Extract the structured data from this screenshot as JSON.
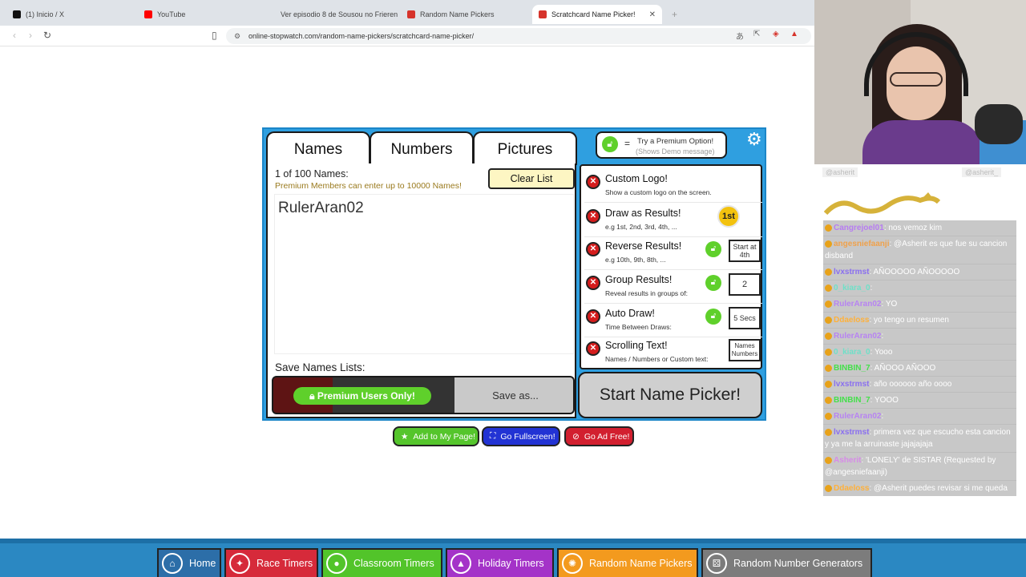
{
  "browser": {
    "tabs": [
      {
        "label": "(1) Inicio / X",
        "icon": "x-logo-icon",
        "color": "#111111"
      },
      {
        "label": "YouTube",
        "icon": "youtube-icon",
        "color": "#ff0000"
      },
      {
        "label": "Ver episodio 8 de Sousou no Frieren",
        "icon": "crunchy-icon",
        "color": "#f47521"
      },
      {
        "label": "Random Name Pickers",
        "icon": "stopwatch-icon",
        "color": "#d6332b"
      },
      {
        "label": "Scratchcard Name Picker!",
        "icon": "stopwatch-icon",
        "color": "#d6332b"
      }
    ],
    "close_glyph": "✕",
    "new_tab_glyph": "+",
    "url": "online-stopwatch.com/random-name-pickers/scratchcard-name-picker/"
  },
  "app": {
    "tabs": [
      "Names",
      "Numbers",
      "Pictures"
    ],
    "count_text": "1 of 100 Names:",
    "premium_note": "Premium Members can enter  up to 10000 Names!",
    "clear_label": "Clear List",
    "names_value": "RulerAran02",
    "save_label": "Save Names Lists:",
    "premium_only_label": "Premium Users Only!",
    "save_as_label": "Save as...",
    "premium_option_eq": "=",
    "premium_option_title": "Try a Premium Option!",
    "premium_option_sub": "(Shows Demo message)",
    "start_label": "Start Name Picker!",
    "options": [
      {
        "title": "Custom Logo!",
        "sub": "Show a custom logo on the screen.",
        "locked": false,
        "box": ""
      },
      {
        "title": "Draw as Results!",
        "sub": "e.g 1st, 2nd, 3rd, 4th, ...",
        "locked": false,
        "box": "",
        "medal": "1st"
      },
      {
        "title": "Reverse Results!",
        "sub": "e.g 10th, 9th, 8th, ...",
        "locked": true,
        "box": "Start at 4th"
      },
      {
        "title": "Group Results!",
        "sub": "Reveal results in groups of:",
        "locked": true,
        "box": "2"
      },
      {
        "title": "Auto Draw!",
        "sub": "Time Between Draws:",
        "locked": true,
        "box": "5 Secs"
      },
      {
        "title": "Scrolling Text!",
        "sub": "Names / Numbers or Custom text:",
        "locked": false,
        "box": "Names Numbers"
      }
    ]
  },
  "page_buttons": {
    "add_to_page": "Add to My Page!",
    "fullscreen": "Go Fullscreen!",
    "ad_free": "Go Ad Free!"
  },
  "bottom_nav": [
    {
      "label": "Home",
      "color": "#2c6ea8"
    },
    {
      "label": "Race Timers",
      "color": "#d62a3a"
    },
    {
      "label": "Classroom Timers",
      "color": "#52c42a"
    },
    {
      "label": "Holiday Timers",
      "color": "#a433c8"
    },
    {
      "label": "Random Name Pickers",
      "color": "#f39a1e"
    },
    {
      "label": "Random Number Generators",
      "color": "#7c7c7c"
    }
  ],
  "stream": {
    "header_left": "@asherit",
    "header_right": "@asherit_",
    "chat": [
      {
        "user": "Cangrejoel01",
        "text": ": nos vemoz kim",
        "color": "#b77cf2"
      },
      {
        "user": "angesniefaanji",
        "text": ": @Asherit es que fue su cancion disband",
        "color": "#f0a14a"
      },
      {
        "user": "lvxstrmst",
        "text": ": AÑOOOOO AÑOOOOO",
        "color": "#8a6ff0"
      },
      {
        "user": "0_kiara_0",
        "text": ": ",
        "color": "#6fe0c8"
      },
      {
        "user": "RulerAran02",
        "text": ": YO",
        "color": "#b783f2"
      },
      {
        "user": "Ddaeloss",
        "text": ": yo tengo un resumen",
        "color": "#ffb13b"
      },
      {
        "user": "RulerAran02",
        "text": ": ",
        "color": "#b783f2"
      },
      {
        "user": "0_kiara_0",
        "text": ": Yooo",
        "color": "#6fe0c8"
      },
      {
        "user": "BINBIN_7",
        "text": ": AÑOOO AÑOOO",
        "color": "#44e04a"
      },
      {
        "user": "lvxstrmst",
        "text": ": año oooooo año oooo",
        "color": "#8a6ff0"
      },
      {
        "user": "BINBIN_7",
        "text": ": YOOO",
        "color": "#44e04a"
      },
      {
        "user": "RulerAran02",
        "text": ": ",
        "color": "#b783f2"
      },
      {
        "user": "lvxstrmst",
        "text": ": primera vez que escucho esta cancion y ya me la arruinaste jajajajaja",
        "color": "#8a6ff0"
      },
      {
        "user": "Asherit",
        "text": ": 'LONELY' de SISTAR (Requested by @angesniefaanji)",
        "color": "#d78be8"
      },
      {
        "user": "Ddaeloss",
        "text": ": @Asherit puedes revisar si me queda algun resumen",
        "color": "#ffb13b"
      }
    ]
  }
}
